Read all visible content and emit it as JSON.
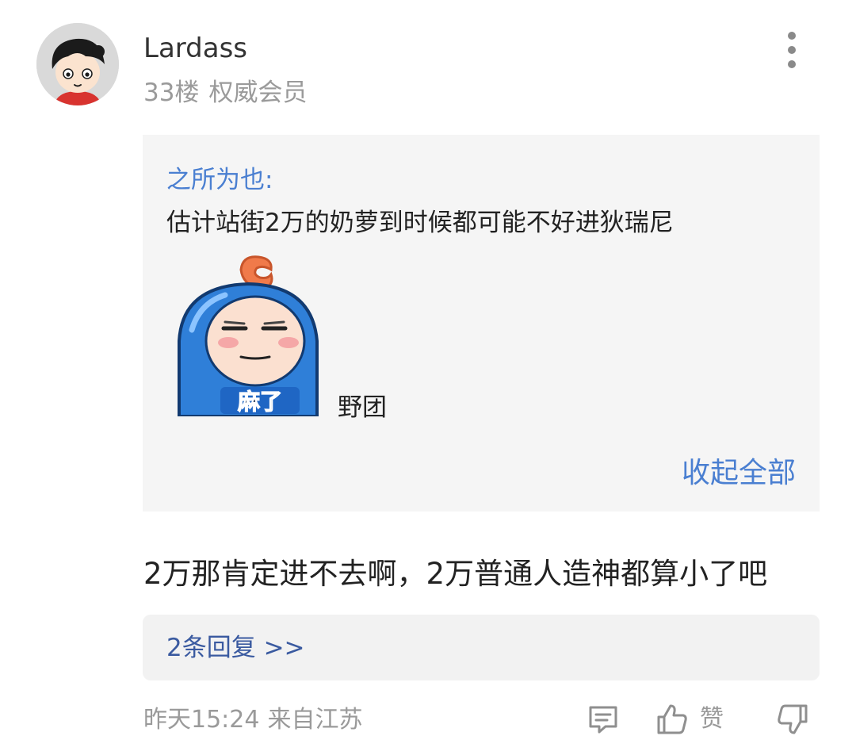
{
  "post": {
    "username": "Lardass",
    "floor": "33楼",
    "member_level": "权威会员",
    "avatar_icon": "cartoon-boy-avatar",
    "more_icon": "more-vertical-icon"
  },
  "quote": {
    "author": "之所为也:",
    "text": "估计站街2万的奶萝到时候都可能不好进狄瑞尼",
    "sticker_text": "麻了",
    "sticker_caption": "野团",
    "collapse_label": "收起全部",
    "link_color": "#4a7fd1"
  },
  "comment": {
    "text": "2万那肯定进不去啊，2万普通人造神都算小了吧"
  },
  "replies": {
    "label": "2条回复 >>"
  },
  "footer": {
    "time": "昨天15:24",
    "location": "来自江苏",
    "reply_icon": "comment-icon",
    "like_icon": "thumbs-up-icon",
    "like_label": "赞",
    "dislike_icon": "thumbs-down-icon"
  }
}
